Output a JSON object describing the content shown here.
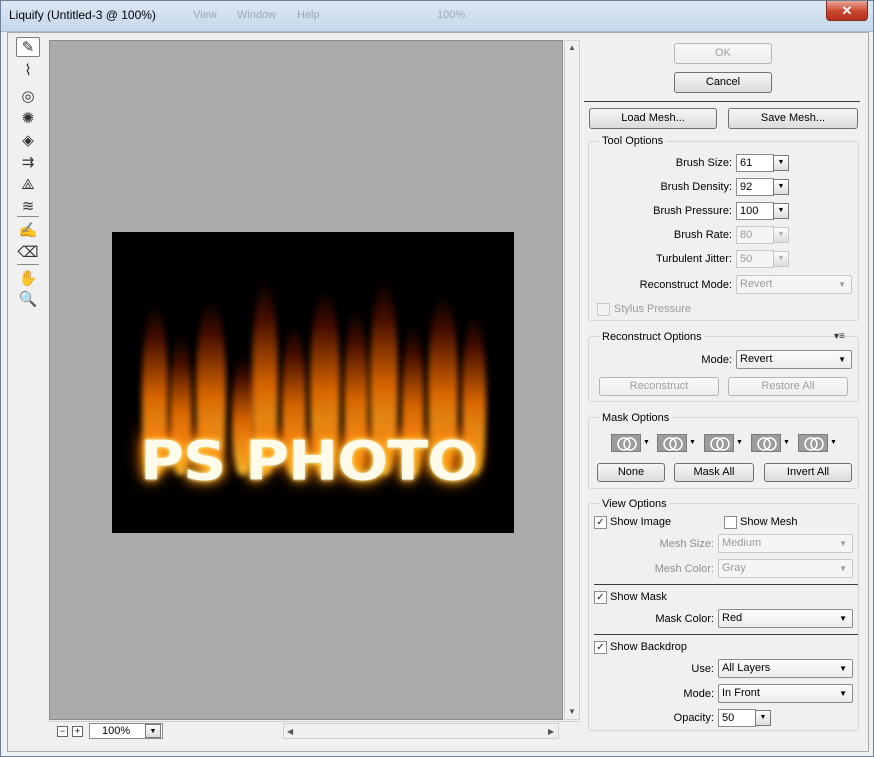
{
  "window": {
    "title": "Liquify (Untitled-3 @ 100%)",
    "close_glyph": "✕",
    "background_menu": [
      "View",
      "Window",
      "Help"
    ],
    "background_zoom": "100%"
  },
  "tools": [
    {
      "name": "forward-warp-tool",
      "glyph": "✎",
      "active": true
    },
    {
      "name": "reconstruct-tool",
      "glyph": "⌇"
    },
    {
      "name": "twirl-clockwise-tool",
      "glyph": "◎"
    },
    {
      "name": "pucker-tool",
      "glyph": "✺"
    },
    {
      "name": "bloat-tool",
      "glyph": "◈"
    },
    {
      "name": "push-left-tool",
      "glyph": "⇉"
    },
    {
      "name": "mirror-tool",
      "glyph": "⟁"
    },
    {
      "name": "turbulence-tool",
      "glyph": "≋"
    },
    {
      "name": "freeze-mask-tool",
      "glyph": "✍"
    },
    {
      "name": "thaw-mask-tool",
      "glyph": "⌫"
    },
    {
      "name": "hand-tool",
      "glyph": "✋"
    },
    {
      "name": "zoom-tool",
      "glyph": "🔍"
    }
  ],
  "canvas": {
    "image_text": "PS PHOTO",
    "zoom_value": "100%",
    "zoom_out": "−",
    "zoom_in": "+"
  },
  "buttons": {
    "ok": "OK",
    "cancel": "Cancel",
    "load_mesh": "Load Mesh...",
    "save_mesh": "Save Mesh..."
  },
  "tool_options": {
    "title": "Tool Options",
    "brush_size_label": "Brush Size:",
    "brush_size": "61",
    "brush_density_label": "Brush Density:",
    "brush_density": "92",
    "brush_pressure_label": "Brush Pressure:",
    "brush_pressure": "100",
    "brush_rate_label": "Brush Rate:",
    "brush_rate": "80",
    "turbulent_jitter_label": "Turbulent Jitter:",
    "turbulent_jitter": "50",
    "reconstruct_mode_label": "Reconstruct Mode:",
    "reconstruct_mode": "Revert",
    "stylus_pressure": "Stylus Pressure"
  },
  "reconstruct_options": {
    "title": "Reconstruct Options",
    "mode_label": "Mode:",
    "mode": "Revert",
    "reconstruct": "Reconstruct",
    "restore_all": "Restore All"
  },
  "mask_options": {
    "title": "Mask Options",
    "none": "None",
    "mask_all": "Mask All",
    "invert_all": "Invert All"
  },
  "view_options": {
    "title": "View Options",
    "show_image": "Show Image",
    "show_mesh": "Show Mesh",
    "mesh_size_label": "Mesh Size:",
    "mesh_size": "Medium",
    "mesh_color_label": "Mesh Color:",
    "mesh_color": "Gray",
    "show_mask": "Show Mask",
    "mask_color_label": "Mask Color:",
    "mask_color": "Red",
    "show_backdrop": "Show Backdrop",
    "use_label": "Use:",
    "use": "All Layers",
    "mode_label": "Mode:",
    "mode": "In Front",
    "opacity_label": "Opacity:",
    "opacity": "50"
  },
  "glyphs": {
    "caret": "▼",
    "check": "✓",
    "up": "▲",
    "down": "▼",
    "left": "◀",
    "right": "▶",
    "panel_menu": "▾≡"
  },
  "colors": {
    "canvas_bg": "#ababab",
    "image_bg": "#000000",
    "fire_core": "#fffbea",
    "fire_glow": "#ff8800"
  }
}
